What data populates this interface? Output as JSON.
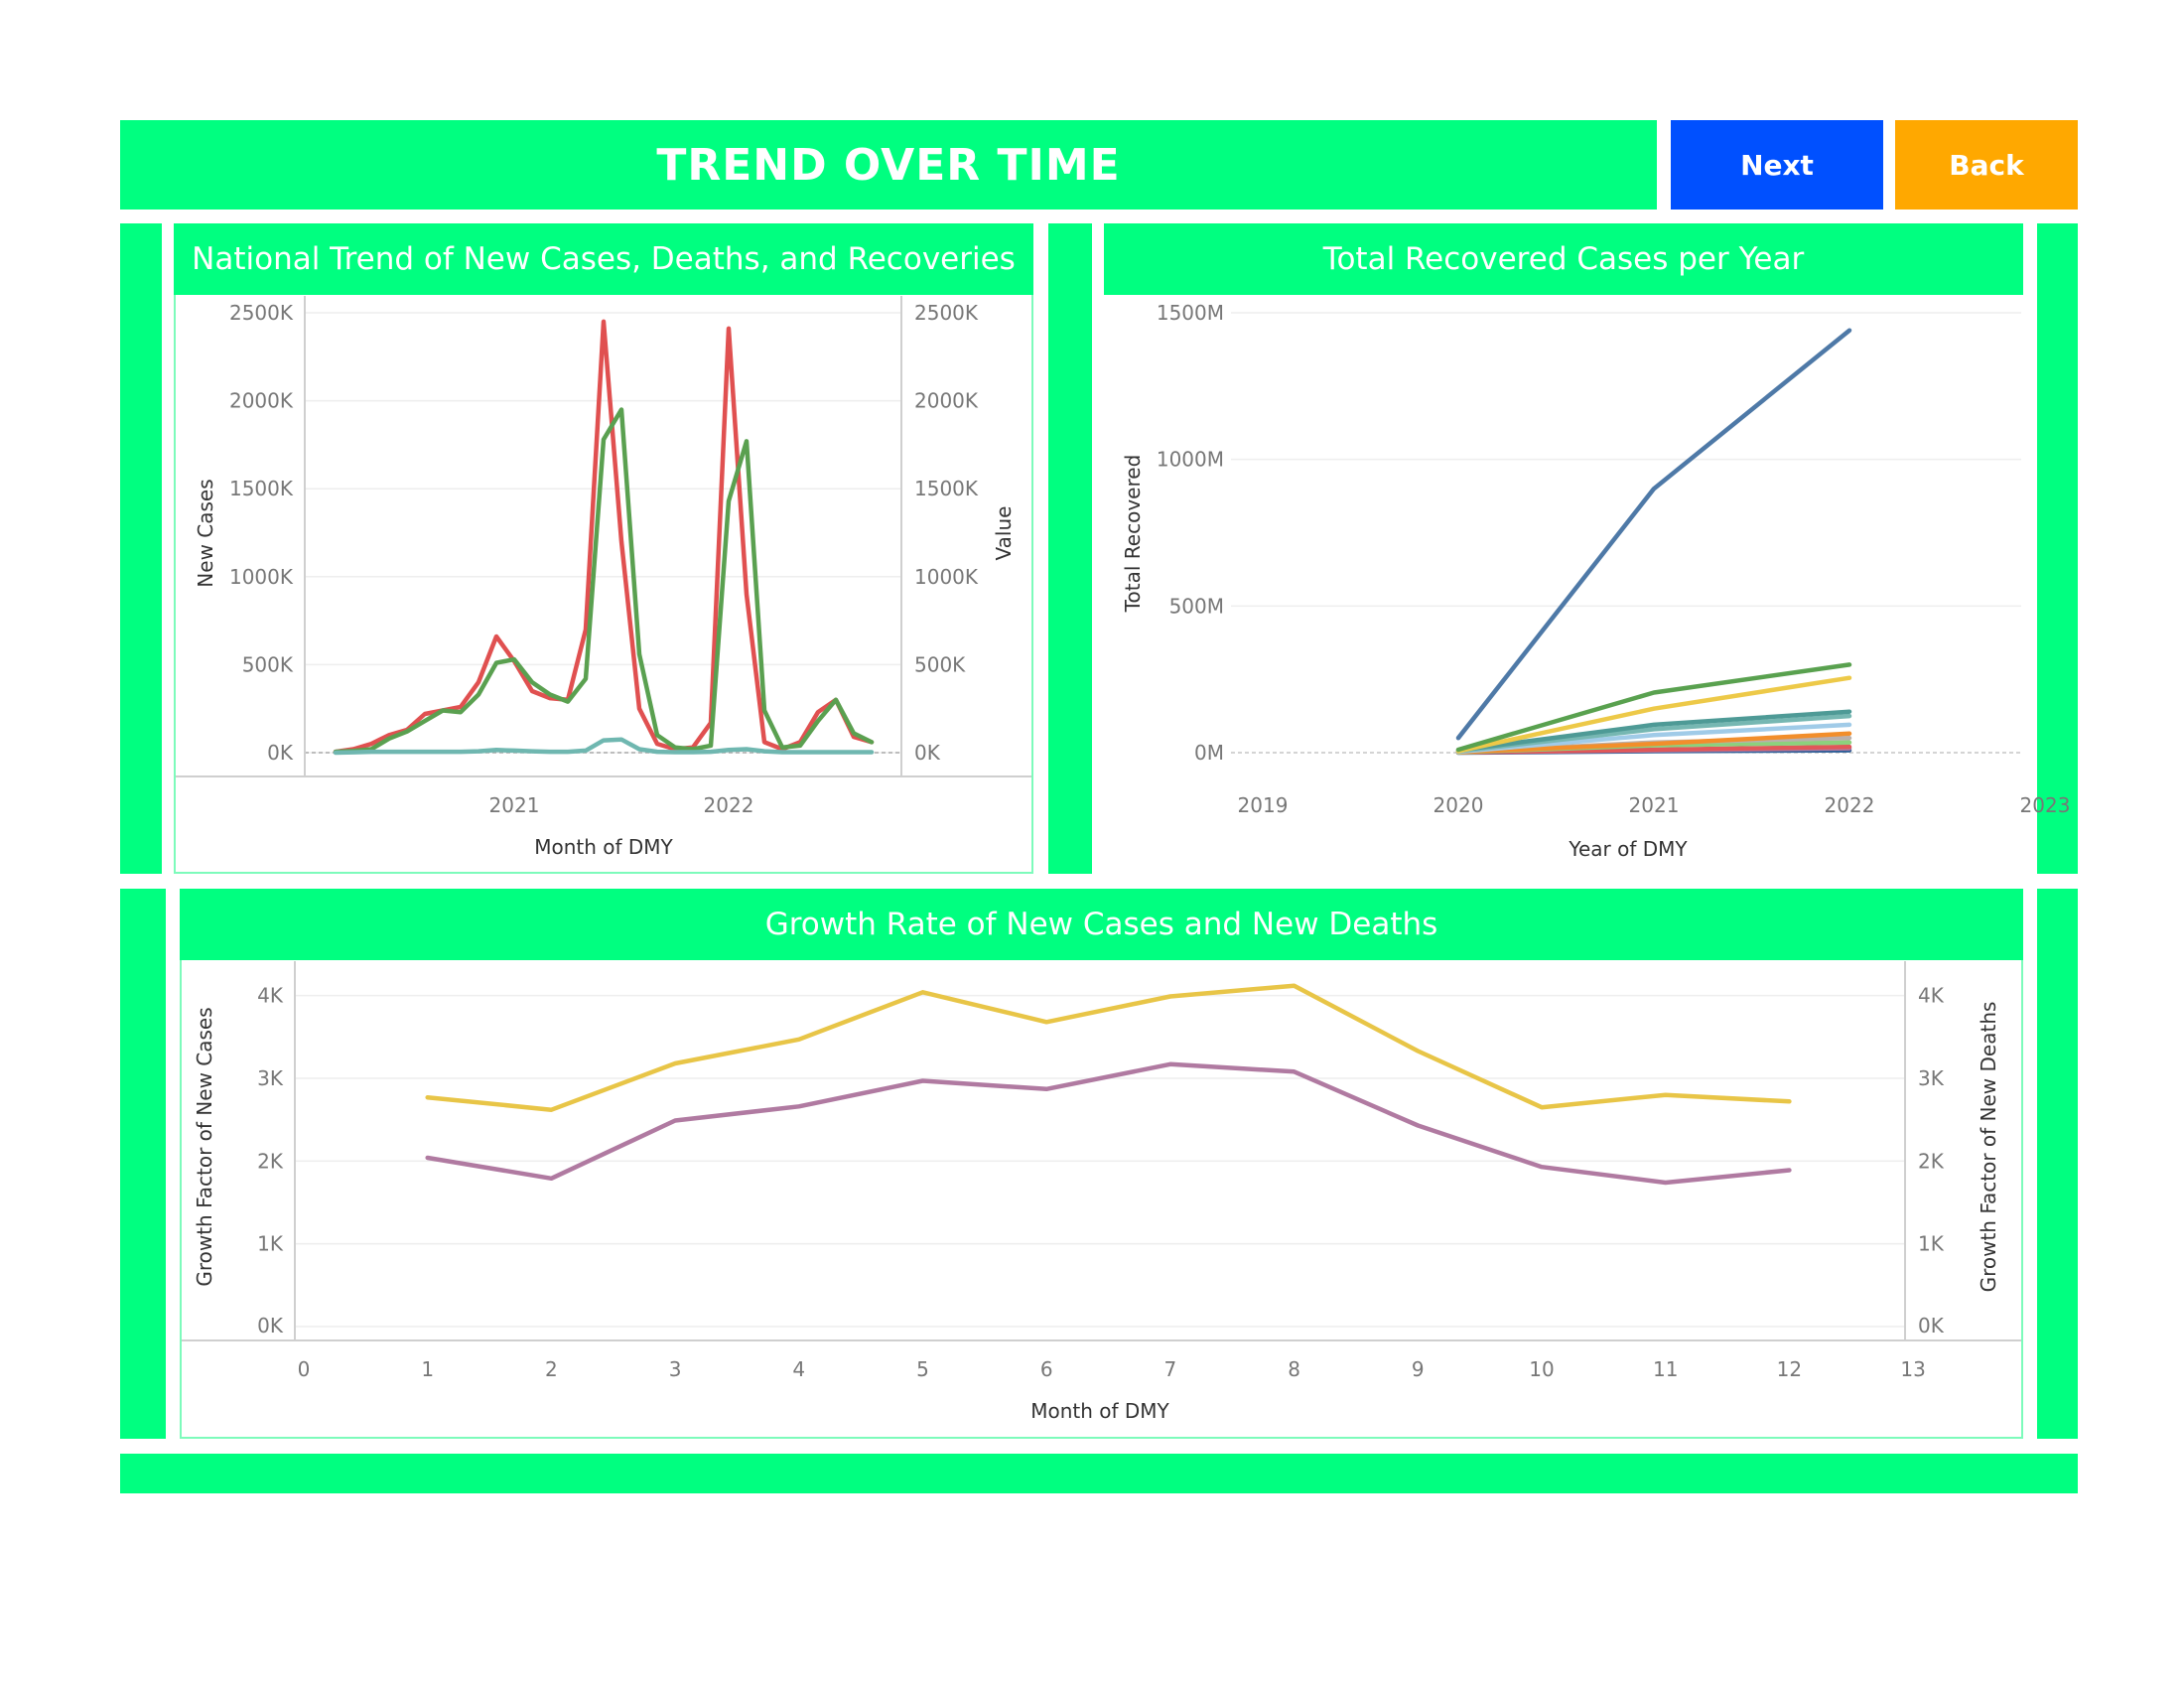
{
  "header": {
    "title": "TREND OVER TIME",
    "next_label": "Next",
    "back_label": "Back"
  },
  "colors": {
    "accent": "#00ff80",
    "next": "#0050ff",
    "back": "#ffa800"
  },
  "chart_data": [
    {
      "type": "line",
      "title": "National Trend of New Cases, Deaths, and Recoveries",
      "xlabel": "Month of DMY",
      "ylabel": "New Cases",
      "ylabel_right": "Value",
      "x_ticks": [
        "2021",
        "2022"
      ],
      "y_ticks": [
        "0K",
        "500K",
        "1000K",
        "1500K",
        "2000K",
        "2500K"
      ],
      "ylim": [
        0,
        2500
      ],
      "x": [
        "2020-03",
        "2020-04",
        "2020-05",
        "2020-06",
        "2020-07",
        "2020-08",
        "2020-09",
        "2020-10",
        "2020-11",
        "2020-12",
        "2021-01",
        "2021-02",
        "2021-03",
        "2021-04",
        "2021-05",
        "2021-06",
        "2021-07",
        "2021-08",
        "2021-09",
        "2021-10",
        "2021-11",
        "2021-12",
        "2022-01",
        "2022-02",
        "2022-03",
        "2022-04",
        "2022-05",
        "2022-06",
        "2022-07",
        "2022-08",
        "2022-09"
      ],
      "series": [
        {
          "color": "#e05050",
          "axis": "left",
          "values": [
            5,
            20,
            50,
            100,
            130,
            220,
            240,
            260,
            400,
            660,
            520,
            350,
            310,
            300,
            700,
            2450,
            1200,
            250,
            50,
            20,
            30,
            170,
            2410,
            900,
            60,
            20,
            60,
            230,
            300,
            90,
            60
          ]
        },
        {
          "color": "#5aa050",
          "axis": "right",
          "values": [
            5,
            10,
            20,
            80,
            120,
            180,
            240,
            230,
            330,
            510,
            530,
            400,
            330,
            290,
            420,
            1780,
            1950,
            560,
            100,
            30,
            20,
            40,
            1430,
            1770,
            240,
            30,
            40,
            180,
            300,
            110,
            60
          ]
        },
        {
          "color": "#6fb7b0",
          "axis": "right",
          "values": [
            0,
            2,
            5,
            5,
            5,
            5,
            5,
            5,
            8,
            15,
            12,
            8,
            5,
            5,
            12,
            70,
            75,
            20,
            5,
            3,
            3,
            5,
            15,
            20,
            8,
            3,
            3,
            3,
            3,
            3,
            3
          ]
        }
      ]
    },
    {
      "type": "line",
      "title": "Total Recovered Cases per Year",
      "xlabel": "Year of DMY",
      "ylabel": "Total Recovered",
      "x_ticks": [
        "2019",
        "2020",
        "2021",
        "2022",
        "2023"
      ],
      "y_ticks": [
        "0M",
        "500M",
        "1000M",
        "1500M"
      ],
      "ylim": [
        0,
        1500
      ],
      "x": [
        2020,
        2021,
        2022
      ],
      "series": [
        {
          "color": "#4e79a7",
          "values": [
            50,
            900,
            1440
          ]
        },
        {
          "color": "#59a14f",
          "values": [
            10,
            205,
            300
          ]
        },
        {
          "color": "#edc948",
          "values": [
            5,
            150,
            255
          ]
        },
        {
          "color": "#4e9a96",
          "values": [
            8,
            95,
            140
          ]
        },
        {
          "color": "#76b7b2",
          "values": [
            5,
            80,
            125
          ]
        },
        {
          "color": "#a0cbe8",
          "values": [
            3,
            60,
            95
          ]
        },
        {
          "color": "#f28e2b",
          "values": [
            2,
            30,
            65
          ]
        },
        {
          "color": "#bab0ac",
          "values": [
            2,
            35,
            50
          ]
        },
        {
          "color": "#8cd17d",
          "values": [
            1,
            25,
            35
          ]
        },
        {
          "color": "#e15759",
          "values": [
            1,
            10,
            20
          ]
        },
        {
          "color": "#b07aa1",
          "values": [
            1,
            8,
            15
          ]
        },
        {
          "color": "#2f5f98",
          "values": [
            0,
            5,
            8
          ]
        }
      ]
    },
    {
      "type": "line",
      "title": "Growth Rate of New Cases and New Deaths",
      "xlabel": "Month of DMY",
      "ylabel": "Growth Factor of New Cases",
      "ylabel_right": "Growth Factor of New Deaths",
      "x_ticks": [
        "0",
        "1",
        "2",
        "3",
        "4",
        "5",
        "6",
        "7",
        "8",
        "9",
        "10",
        "11",
        "12",
        "13"
      ],
      "y_ticks": [
        "0K",
        "1K",
        "2K",
        "3K",
        "4K"
      ],
      "ylim": [
        0,
        4.2
      ],
      "x": [
        1,
        2,
        3,
        4,
        5,
        6,
        7,
        8,
        9,
        10,
        11,
        12
      ],
      "series": [
        {
          "color": "#e8c547",
          "axis": "left",
          "values": [
            2.77,
            2.62,
            3.18,
            3.47,
            4.04,
            3.68,
            3.99,
            4.12,
            3.33,
            2.65,
            2.8,
            2.72
          ]
        },
        {
          "color": "#b07aa1",
          "axis": "right",
          "values": [
            2.04,
            1.79,
            2.49,
            2.66,
            2.97,
            2.87,
            3.17,
            3.08,
            2.43,
            1.93,
            1.74,
            1.89
          ]
        }
      ]
    }
  ]
}
